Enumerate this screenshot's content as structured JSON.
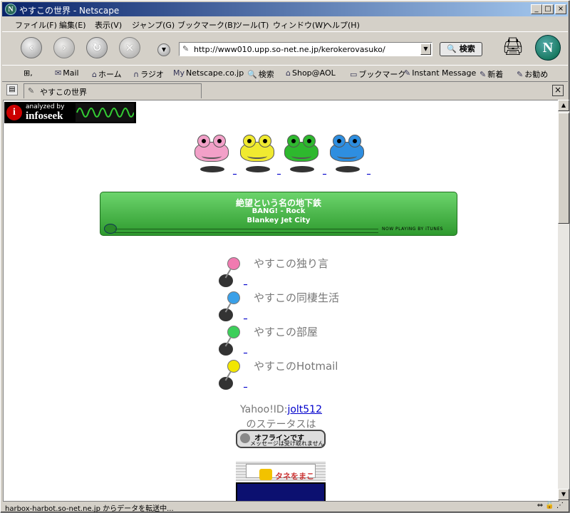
{
  "window": {
    "title": "やすこの世界 - Netscape",
    "app_icon": "N"
  },
  "menu": [
    "ファイル(F)",
    "編集(E)",
    "表示(V)",
    "ジャンプ(G)",
    "ブックマーク(B)",
    "ツール(T)",
    "ウィンドウ(W)",
    "ヘルプ(H)"
  ],
  "nav": {
    "url": "http://www010.upp.so-net.ne.jp/kerokerovasuko/",
    "search_label": "検索",
    "logo": "N"
  },
  "personal_toolbar": [
    "Mail",
    "ホーム",
    "ラジオ",
    "Netscape.co.jp",
    "検索",
    "Shop@AOL",
    "ブックマーク",
    "Instant Message",
    "新着",
    "お勧め"
  ],
  "tab": {
    "title": "やすこの世界"
  },
  "status": {
    "text": "harbox-harbot.so-net.ne.jp からデータを転送中..."
  },
  "page": {
    "infoseek": {
      "line1": "analyzed by",
      "line2": "infoseek",
      "logo_letter": "i"
    },
    "frogs": [
      {
        "color": "#f2a0c8",
        "link": "_"
      },
      {
        "color": "#f0ea30",
        "link": "_"
      },
      {
        "color": "#2eb82e",
        "link": "_"
      },
      {
        "color": "#2e8ee0",
        "link": "_"
      }
    ],
    "now_playing": {
      "song": "絶望という名の地下鉄",
      "album_genre": "BANG! - Rock",
      "artist": "Blankey Jet City",
      "tag": "NOW PLAYING BY iTUNES"
    },
    "pins": [
      {
        "label": "やすこの独り言",
        "color": "#f07ab0",
        "link": "_"
      },
      {
        "label": "やすこの同棲生活",
        "color": "#3aa0e8",
        "link": "_"
      },
      {
        "label": "やすこの部屋",
        "color": "#3ccf5a",
        "link": "_"
      },
      {
        "label": "やすこのHotmail",
        "color": "#f2e600",
        "link": "_"
      }
    ],
    "yahoo": {
      "prefix": "Yahoo!ID:",
      "id": "jolt512",
      "status_text": "のステータスは"
    },
    "offline": {
      "title": "オフラインです",
      "sub": "メッセージは受け取れません"
    },
    "tane": {
      "label": "タネをまこう!"
    }
  }
}
